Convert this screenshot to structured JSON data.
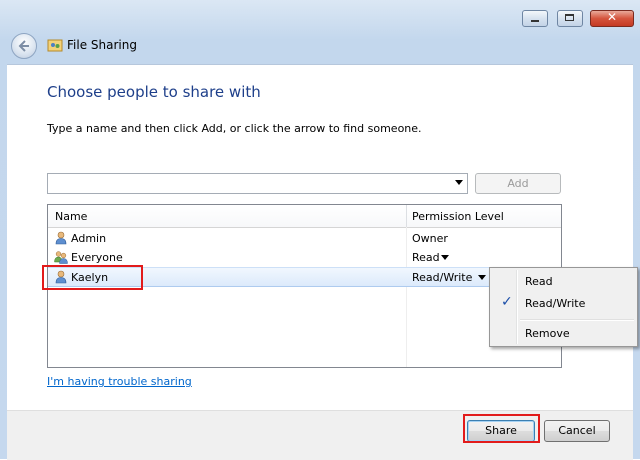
{
  "window": {
    "title": "File Sharing",
    "minimize_icon": "minimize-icon",
    "maximize_icon": "maximize-icon",
    "close_label": "✕"
  },
  "content": {
    "heading": "Choose people to share with",
    "instructions": "Type a name and then click Add, or click the arrow to find someone.",
    "name_input": {
      "value": "",
      "placeholder": ""
    },
    "add_label": "Add"
  },
  "list": {
    "columns": {
      "name": "Name",
      "permission": "Permission Level"
    },
    "rows": [
      {
        "name": "Admin",
        "permission": "Owner",
        "icon": "user-icon",
        "has_dropdown": false
      },
      {
        "name": "Everyone",
        "permission": "Read",
        "icon": "group-icon",
        "has_dropdown": true
      },
      {
        "name": "Kaelyn",
        "permission": "Read/Write",
        "icon": "user-icon",
        "has_dropdown": true,
        "selected": true
      }
    ]
  },
  "permission_menu": {
    "items": [
      {
        "label": "Read",
        "checked": false
      },
      {
        "label": "Read/Write",
        "checked": true
      },
      {
        "label": "Remove",
        "checked": false
      }
    ],
    "check_glyph": "✓"
  },
  "help_link": "I'm having trouble sharing",
  "footer": {
    "share_label": "Share",
    "cancel_label": "Cancel"
  },
  "colors": {
    "heading": "#1e3f8a",
    "link": "#0066cc",
    "highlight": "#e21b1b"
  }
}
